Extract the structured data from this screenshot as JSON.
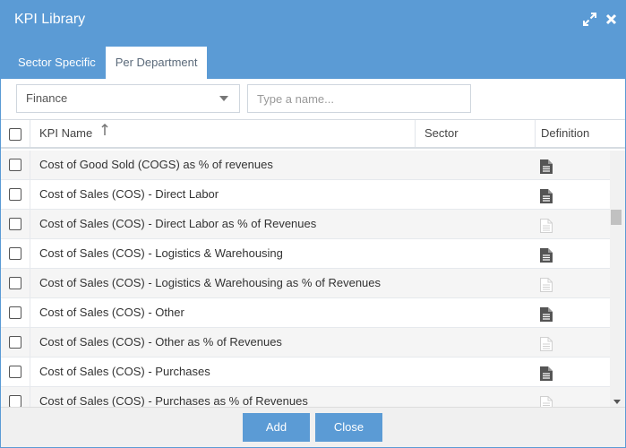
{
  "dialog": {
    "title": "KPI Library",
    "icons": [
      "expand-icon",
      "close-icon"
    ]
  },
  "tabs": [
    {
      "label": "Sector Specific",
      "active": false
    },
    {
      "label": "Per Department",
      "active": true
    }
  ],
  "filters": {
    "department_selected": "Finance",
    "name_placeholder": "Type a name..."
  },
  "grid": {
    "headers": {
      "name": "KPI Name",
      "sector": "Sector",
      "definition": "Definition"
    },
    "sort_icon": "sort-ascending-icon",
    "rows": [
      {
        "name": "Cost of Good Sold (COGS) as % of revenues",
        "sector": "",
        "has_definition": true
      },
      {
        "name": "Cost of Sales (COS) - Direct Labor",
        "sector": "",
        "has_definition": true
      },
      {
        "name": "Cost of Sales (COS) - Direct Labor as % of Revenues",
        "sector": "",
        "has_definition": false
      },
      {
        "name": "Cost of Sales (COS) - Logistics & Warehousing",
        "sector": "",
        "has_definition": true
      },
      {
        "name": "Cost of Sales (COS) - Logistics & Warehousing as % of Revenues",
        "sector": "",
        "has_definition": false
      },
      {
        "name": "Cost of Sales (COS) - Other",
        "sector": "",
        "has_definition": true
      },
      {
        "name": "Cost of Sales (COS) - Other as % of Revenues",
        "sector": "",
        "has_definition": false
      },
      {
        "name": "Cost of Sales (COS) - Purchases",
        "sector": "",
        "has_definition": true
      },
      {
        "name": "Cost of Sales (COS) - Purchases as % of Revenues",
        "sector": "",
        "has_definition": false
      }
    ]
  },
  "footer": {
    "add_label": "Add",
    "close_label": "Close"
  },
  "colors": {
    "accent": "#5b9bd5",
    "doc_icon_active": "#555555",
    "doc_icon_inactive": "#d0d0d0"
  }
}
